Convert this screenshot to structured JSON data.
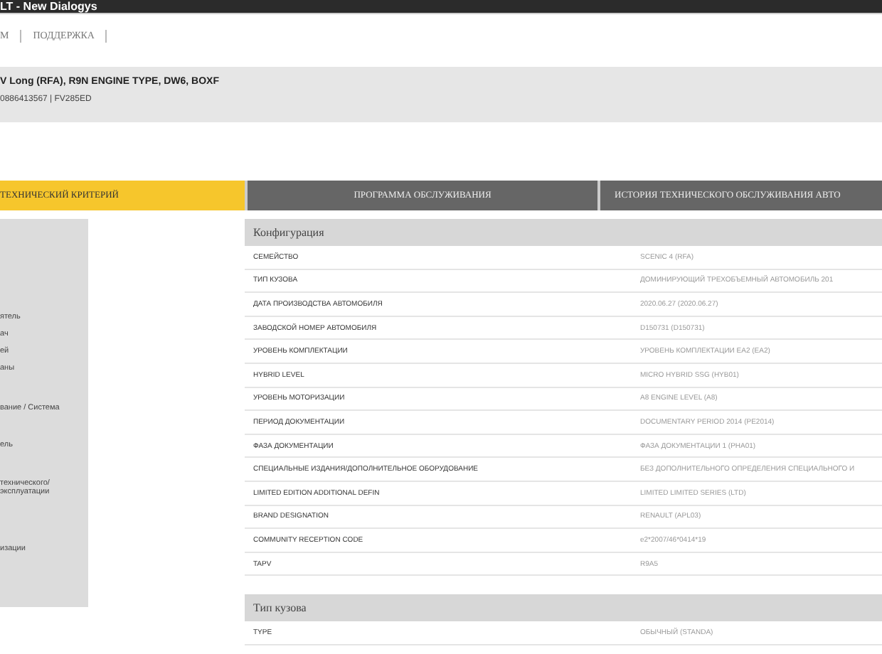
{
  "window": {
    "title": "LT - New Dialogys"
  },
  "nav": [
    {
      "label": "М",
      "selected": false
    },
    {
      "label": "ПОДДЕРЖКА",
      "selected": false
    }
  ],
  "vehicle": {
    "title": "V Long (RFA), R9N ENGINE TYPE, DW6, BOXF",
    "subtitle": "0886413567 | FV285ED"
  },
  "tabs": [
    {
      "label": "ТЕХНИЧЕСКИЙ КРИТЕРИЙ",
      "selected": true
    },
    {
      "label": "ПРОГРАММА ОБСЛУЖИВАНИЯ",
      "selected": false
    },
    {
      "label": "ИСТОРИЯ ТЕХНИЧЕСКОГО ОБСЛУЖИВАНИЯ АВТО",
      "selected": false
    }
  ],
  "sidebar": {
    "items": [
      "ятель",
      "ач",
      "ей",
      "аны",
      "вание / Система",
      "ель",
      "технического/эксплуатации",
      "изации"
    ]
  },
  "sections": [
    {
      "title": "Конфигурация",
      "rows": [
        {
          "label": "СЕМЕЙСТВО",
          "value": "SCENIC 4 (RFA)"
        },
        {
          "label": "ТИП КУЗОВА",
          "value": "ДОМИНИРУЮЩИЙ ТРЕХОБЪЕМНЫЙ АВТОМОБИЛЬ 201"
        },
        {
          "label": "ДАТА ПРОИЗВОДСТВА АВТОМОБИЛЯ",
          "value": "2020.06.27 (2020.06.27)"
        },
        {
          "label": "ЗАВОДСКОЙ НОМЕР АВТОМОБИЛЯ",
          "value": "D150731 (D150731)"
        },
        {
          "label": "УРОВЕНЬ КОМПЛЕКТАЦИИ",
          "value": "УРОВЕНЬ КОМПЛЕКТАЦИИ EA2 (EA2)"
        },
        {
          "label": "HYBRID LEVEL",
          "value": "MICRO HYBRID SSG (HYB01)"
        },
        {
          "label": "УРОВЕНЬ МОТОРИЗАЦИИ",
          "value": "A8 ENGINE LEVEL (A8)"
        },
        {
          "label": "ПЕРИОД ДОКУМЕНТАЦИИ",
          "value": "DOCUMENTARY PERIOD 2014 (PE2014)"
        },
        {
          "label": "ФАЗА ДОКУМЕНТАЦИИ",
          "value": "ФАЗА ДОКУМЕНТАЦИИ 1 (PHA01)"
        },
        {
          "label": "СПЕЦИАЛЬНЫЕ ИЗДАНИЯ/ДОПОЛНИТЕЛЬНОЕ ОБОРУДОВАНИЕ",
          "value": "БЕЗ ДОПОЛНИТЕЛЬНОГО ОПРЕДЕЛЕНИЯ СПЕЦИАЛЬНОГО И"
        },
        {
          "label": "LIMITED EDITION ADDITIONAL DEFIN",
          "value": "LIMITED LIMITED SERIES (LTD)"
        },
        {
          "label": "BRAND DESIGNATION",
          "value": "RENAULT (APL03)"
        },
        {
          "label": "COMMUNITY RECEPTION CODE",
          "value": "e2*2007/46*0414*19"
        },
        {
          "label": "TAPV",
          "value": "R9A5"
        }
      ]
    },
    {
      "title": "Тип кузова",
      "rows": [
        {
          "label": "TYPE",
          "value": "ОБЫЧНЫЙ (STANDA)"
        }
      ]
    }
  ]
}
